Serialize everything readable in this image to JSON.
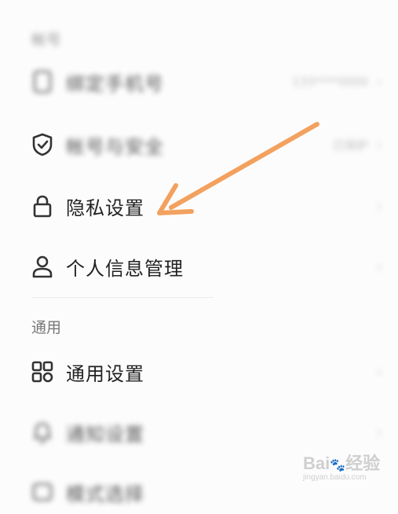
{
  "sections": [
    {
      "title": "帐号"
    },
    {
      "title": "通用"
    }
  ],
  "rows": [
    {
      "label": "绑定手机号",
      "value": "133****0000",
      "icon": "phone-icon"
    },
    {
      "label": "帐号与安全",
      "value": "已保护",
      "icon": "shield-check-icon"
    },
    {
      "label": "隐私设置",
      "icon": "lock-icon"
    },
    {
      "label": "个人信息管理",
      "icon": "user-icon"
    },
    {
      "label": "通用设置",
      "icon": "grid-icon"
    },
    {
      "label": "通知设置",
      "icon": "bell-icon"
    },
    {
      "label": "模式选择",
      "icon": "mode-icon"
    }
  ],
  "annotation": {
    "color": "#f3a15e",
    "icon": "arrow-annotation"
  },
  "watermark": {
    "logo": "Bai",
    "suffix": "经验",
    "site": "jingyan.baidu.com"
  }
}
